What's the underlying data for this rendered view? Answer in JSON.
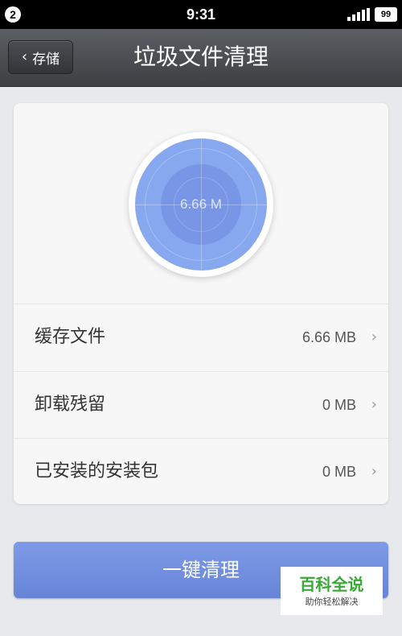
{
  "status_bar": {
    "notification_count": "2",
    "time": "9:31",
    "battery": "99"
  },
  "nav": {
    "back_label": "存储",
    "title": "垃圾文件清理"
  },
  "summary": {
    "total_size": "6.66 M"
  },
  "items": [
    {
      "label": "缓存文件",
      "value": "6.66 MB"
    },
    {
      "label": "卸载残留",
      "value": "0 MB"
    },
    {
      "label": "已安装的安装包",
      "value": "0 MB"
    }
  ],
  "clean_button": {
    "label": "一键清理"
  },
  "watermark": {
    "title": "百科全说",
    "subtitle": "助你轻松解决"
  },
  "colors": {
    "accent": "#7a96e4",
    "disc": "#87a7ef",
    "nav_bg": "#4a4d52"
  }
}
